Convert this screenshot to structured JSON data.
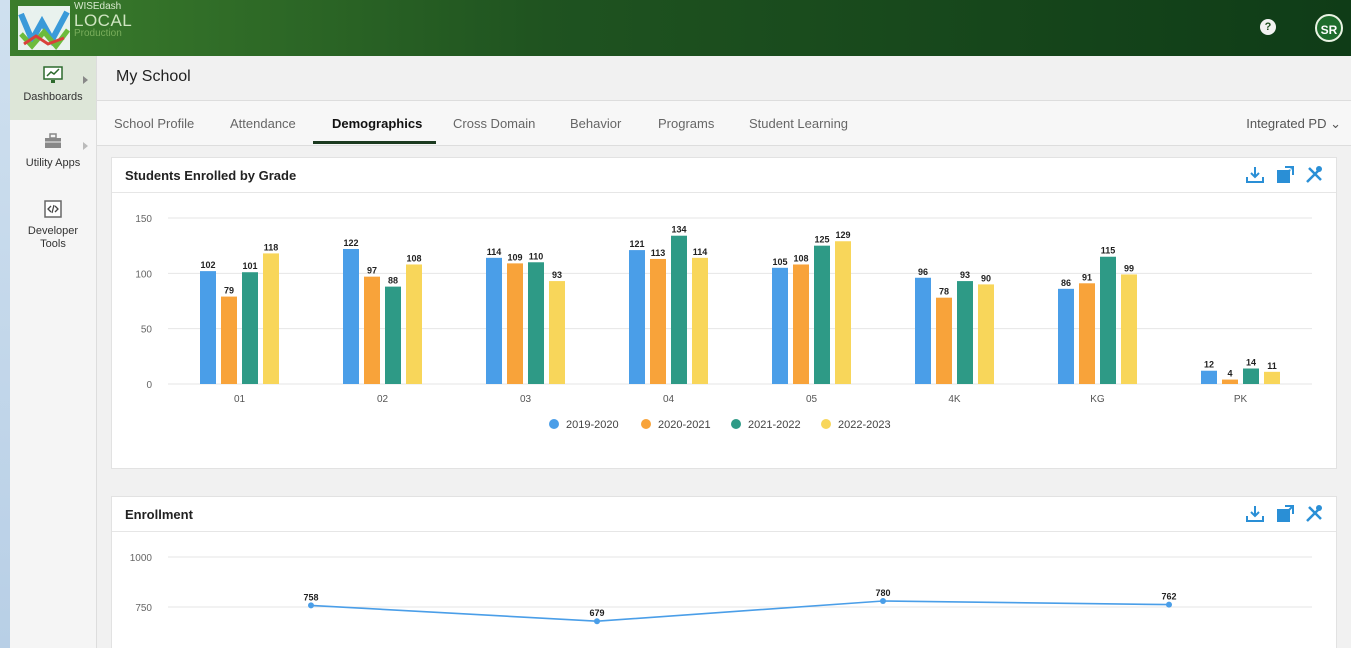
{
  "brand": {
    "line1": "WISEdash",
    "line2": "LOCAL",
    "line3": "Production"
  },
  "header": {
    "help_glyph": "?",
    "avatar_initials": "SR"
  },
  "sidebar": {
    "items": [
      {
        "label": "Dashboards",
        "icon": "dashboard-monitor-icon",
        "active": true
      },
      {
        "label": "Utility Apps",
        "icon": "toolbox-icon"
      },
      {
        "label": "Developer Tools",
        "icon": "code-icon"
      }
    ]
  },
  "page": {
    "title": "My School"
  },
  "tabs": [
    "School Profile",
    "Attendance",
    "Demographics",
    "Cross Domain",
    "Behavior",
    "Programs",
    "Student Learning"
  ],
  "active_tab": "Demographics",
  "right_menu": {
    "label": "Integrated PD",
    "chevron": "⌄"
  },
  "colors": {
    "series": [
      "#4a9ee8",
      "#f8a33a",
      "#2e9a86",
      "#f8d65a"
    ],
    "line": "#4a9ee8"
  },
  "cards": {
    "grade": {
      "title": "Students Enrolled by Grade",
      "toolbar": [
        "download-icon",
        "expand-icon",
        "tools-icon"
      ]
    },
    "enrollment": {
      "title": "Enrollment",
      "toolbar": [
        "download-icon",
        "expand-icon",
        "tools-icon"
      ]
    }
  },
  "chart_data": [
    {
      "type": "bar",
      "title": "Students Enrolled by Grade",
      "categories": [
        "01",
        "02",
        "03",
        "04",
        "05",
        "4K",
        "KG",
        "PK"
      ],
      "series": [
        {
          "name": "2019-2020",
          "values": [
            102,
            122,
            114,
            121,
            105,
            96,
            86,
            12
          ]
        },
        {
          "name": "2020-2021",
          "values": [
            79,
            97,
            109,
            113,
            108,
            78,
            91,
            4
          ]
        },
        {
          "name": "2021-2022",
          "values": [
            101,
            88,
            110,
            134,
            125,
            93,
            115,
            14
          ]
        },
        {
          "name": "2022-2023",
          "values": [
            118,
            108,
            93,
            114,
            129,
            90,
            99,
            11
          ]
        }
      ],
      "ylim": [
        0,
        150
      ],
      "yticks": [
        0,
        50,
        100,
        150
      ],
      "legend": "bottom-center",
      "grid": true
    },
    {
      "type": "line",
      "title": "Enrollment",
      "values": [
        758,
        679,
        780,
        762
      ],
      "ylim": [
        0,
        1000
      ],
      "yticks": [
        750,
        1000
      ],
      "grid": true
    }
  ]
}
